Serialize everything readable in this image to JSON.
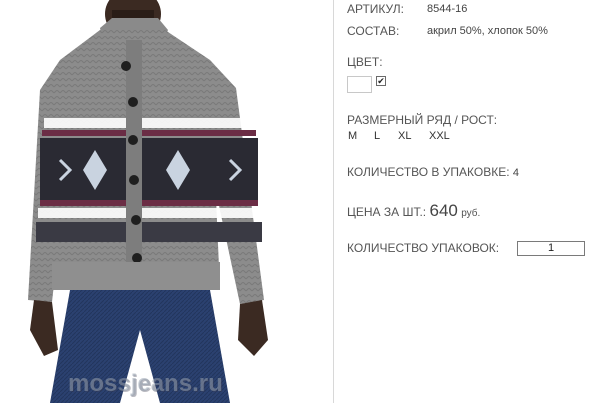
{
  "product": {
    "article_label": "АРТИКУЛ:",
    "article_value": "8544-16",
    "composition_label": "СОСТАВ:",
    "composition_value": "акрил 50%, хлопок 50%",
    "color_label": "ЦВЕТ:",
    "color_swatch": "#ffffff",
    "size_label": "РАЗМЕРНЫЙ РЯД / РОСТ:",
    "sizes": [
      "M",
      "L",
      "XL",
      "XXL"
    ],
    "pack_qty_label": "КОЛИЧЕСТВО В УПАКОВКЕ:",
    "pack_qty_value": "4",
    "price_label": "ЦЕНА ЗА ШТ.:",
    "price_value": "640",
    "price_unit": "руб.",
    "order_qty_label": "КОЛИЧЕСТВО УПАКОВОК:",
    "order_qty_value": "1"
  },
  "image": {
    "watermark": "mossjeans.ru",
    "sweater_color": "#8a8a8a",
    "jeans_color": "#2a3f6b"
  }
}
